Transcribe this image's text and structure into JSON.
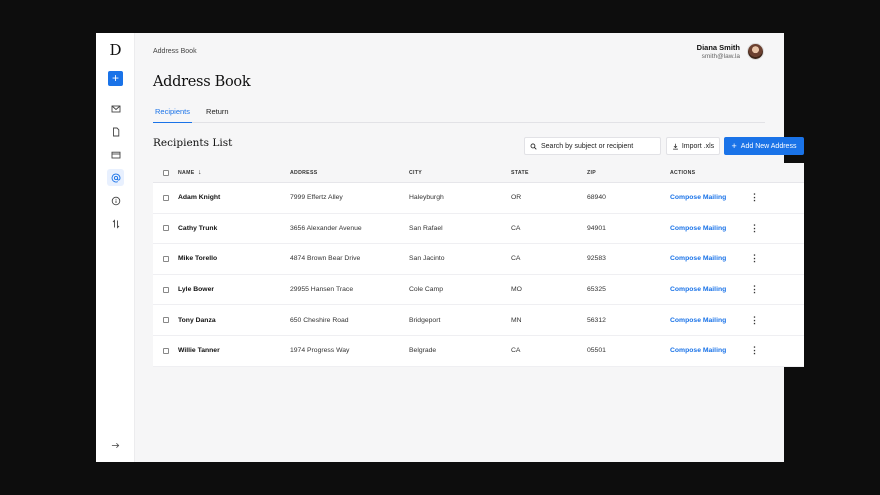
{
  "app": {
    "logo": "D",
    "breadcrumb": "Address Book",
    "page_title": "Address Book"
  },
  "user": {
    "name": "Diana Smith",
    "email": "smith@law.la"
  },
  "sidebar": {
    "new_label": "+",
    "items": [
      {
        "icon": "mail-icon",
        "active": false
      },
      {
        "icon": "document-icon",
        "active": false
      },
      {
        "icon": "card-icon",
        "active": false
      },
      {
        "icon": "at-icon",
        "active": true
      },
      {
        "icon": "info-icon",
        "active": false
      },
      {
        "icon": "sort-icon",
        "active": false
      }
    ],
    "logout_icon": "arrow-right-icon"
  },
  "tabs": [
    {
      "label": "Recipients",
      "active": true
    },
    {
      "label": "Return",
      "active": false
    }
  ],
  "section_title": "Recipients List",
  "toolbar": {
    "search_placeholder": "Search by subject or recipient",
    "import_label": "Import .xls",
    "add_label": "Add New Address"
  },
  "table": {
    "columns": [
      "NAME",
      "ADDRESS",
      "CITY",
      "STATE",
      "ZIP",
      "ACTIONS"
    ],
    "sort_indicator": "↓",
    "rows": [
      {
        "name": "Adam Knight",
        "address": "7999 Effertz Alley",
        "city": "Haleyburgh",
        "state": "OR",
        "zip": "68940",
        "action": "Compose Mailing"
      },
      {
        "name": "Cathy Trunk",
        "address": "3656 Alexander Avenue",
        "city": "San Rafael",
        "state": "CA",
        "zip": "94901",
        "action": "Compose Mailing"
      },
      {
        "name": "Mike Torello",
        "address": "4874 Brown Bear Drive",
        "city": "San Jacinto",
        "state": "CA",
        "zip": "92583",
        "action": "Compose Mailing"
      },
      {
        "name": "Lyle Bower",
        "address": "29955 Hansen Trace",
        "city": "Cole Camp",
        "state": "MO",
        "zip": "65325",
        "action": "Compose Mailing"
      },
      {
        "name": "Tony Danza",
        "address": "650 Cheshire Road",
        "city": "Bridgeport",
        "state": "MN",
        "zip": "56312",
        "action": "Compose Mailing"
      },
      {
        "name": "Willie Tanner",
        "address": "1974 Progress Way",
        "city": "Belgrade",
        "state": "CA",
        "zip": "05501",
        "action": "Compose Mailing"
      }
    ]
  },
  "colors": {
    "accent": "#1a73e8",
    "background": "#f6f6f7"
  }
}
